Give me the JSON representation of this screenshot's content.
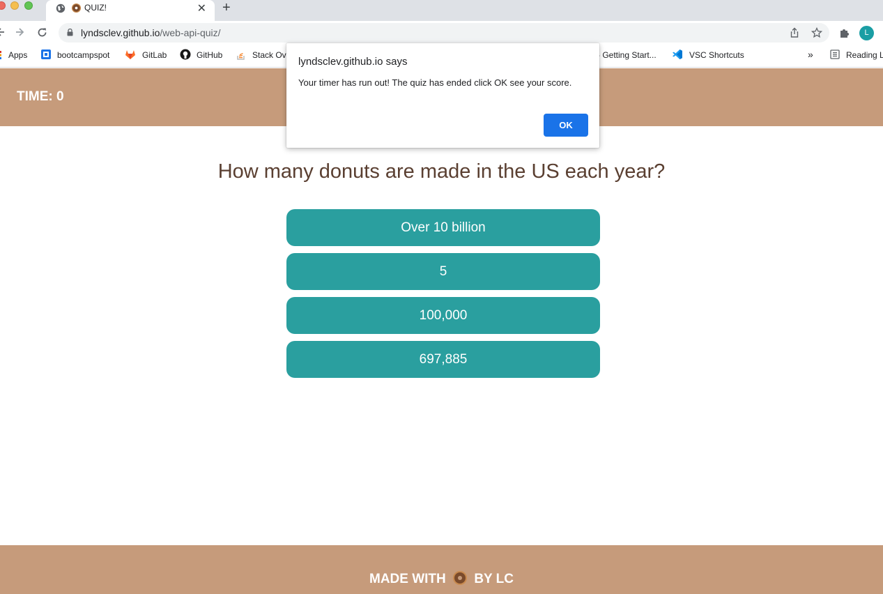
{
  "browser": {
    "tab": {
      "title": "QUIZ!",
      "close_glyph": "✕"
    },
    "new_tab_glyph": "+",
    "url": {
      "host": "lyndsclev.github.io",
      "path": "/web-api-quiz/"
    },
    "avatar_initial": "L",
    "bookmarks": [
      {
        "label": "Apps",
        "icon": "apps-grid-icon"
      },
      {
        "label": "bootcampspot",
        "icon": "bootcampspot-icon"
      },
      {
        "label": "GitLab",
        "icon": "gitlab-icon"
      },
      {
        "label": "GitHub",
        "icon": "github-icon"
      },
      {
        "label": "Stack Ov",
        "icon": "stackoverflow-icon"
      },
      {
        "label": "- Getting Start...",
        "icon": ""
      },
      {
        "label": "VSC Shortcuts",
        "icon": "vscode-icon"
      },
      {
        "label": "»",
        "icon": ""
      },
      {
        "label": "Reading L",
        "icon": "reading-list-icon"
      }
    ]
  },
  "page": {
    "timer": "TIME: 0",
    "question": "How many donuts are made in the US each year?",
    "answers": [
      "Over 10 billion",
      "5",
      "100,000",
      "697,885"
    ],
    "footer": {
      "before": "MADE WITH",
      "after": "BY LC"
    }
  },
  "dialog": {
    "title": "lyndsclev.github.io says",
    "message": "Your timer has run out! The quiz has ended click OK see your score.",
    "ok_label": "OK"
  },
  "colors": {
    "header_bg": "#c69b7b",
    "answer_bg": "#2a9f9f",
    "question_text": "#5a3f31",
    "ok_button": "#1a73e8"
  }
}
